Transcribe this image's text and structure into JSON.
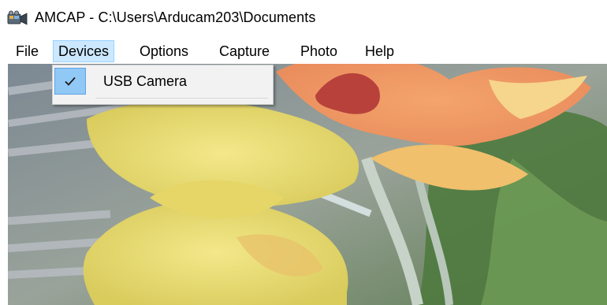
{
  "window": {
    "title": "AMCAP - C:\\Users\\Arducam203\\Documents",
    "icon": "camera-app-icon"
  },
  "menubar": {
    "items": [
      {
        "label": "File"
      },
      {
        "label": "Devices",
        "active": true
      },
      {
        "label": "Options"
      },
      {
        "label": "Capture"
      },
      {
        "label": "Photo"
      },
      {
        "label": "Help"
      }
    ]
  },
  "devices_menu": {
    "items": [
      {
        "label": "USB Camera",
        "checked": true,
        "icon": "checkmark-icon"
      }
    ]
  },
  "colors": {
    "menu_highlight": "#cce8ff",
    "menu_highlight_border": "#99d1ff",
    "check_background": "#90c8f6",
    "dropdown_background": "#f2f2f2"
  }
}
